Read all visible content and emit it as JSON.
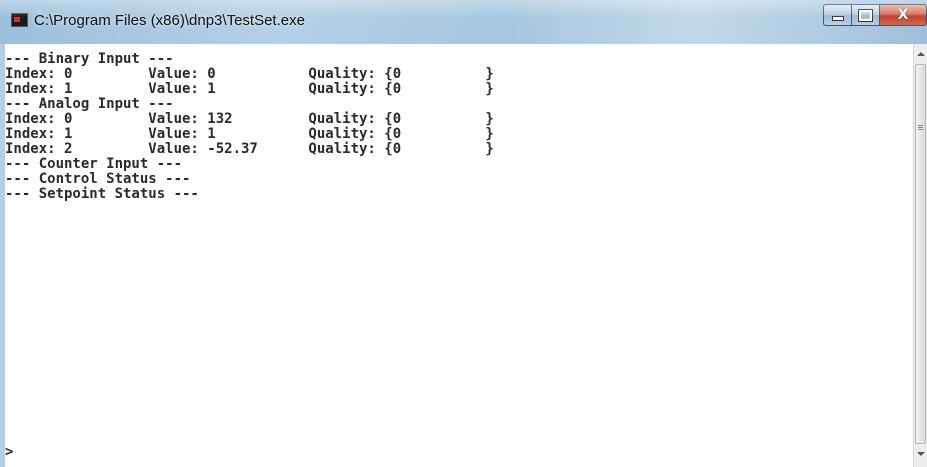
{
  "window": {
    "title": "C:\\Program Files (x86)\\dnp3\\TestSet.exe",
    "icon": "console-app-icon"
  },
  "controls": {
    "minimize_icon": "minimize-icon",
    "maximize_icon": "maximize-icon",
    "close_glyph": "X"
  },
  "console": {
    "lines": [
      "--- Binary Input ---",
      "Index: 0         Value: 0           Quality: {0          }",
      "Index: 1         Value: 1           Quality: {0          }",
      "--- Analog Input ---",
      "Index: 0         Value: 132         Quality: {0          }",
      "Index: 1         Value: 1           Quality: {0          }",
      "Index: 2         Value: -52.37      Quality: {0          }",
      "--- Counter Input ---",
      "--- Control Status ---",
      "--- Setpoint Status ---"
    ],
    "prompt": ">"
  },
  "colors": {
    "titlebar": "#a9c8e0",
    "console_bg": "#ffffff",
    "console_text": "#2a2a2a",
    "close_button": "#c8452e"
  }
}
